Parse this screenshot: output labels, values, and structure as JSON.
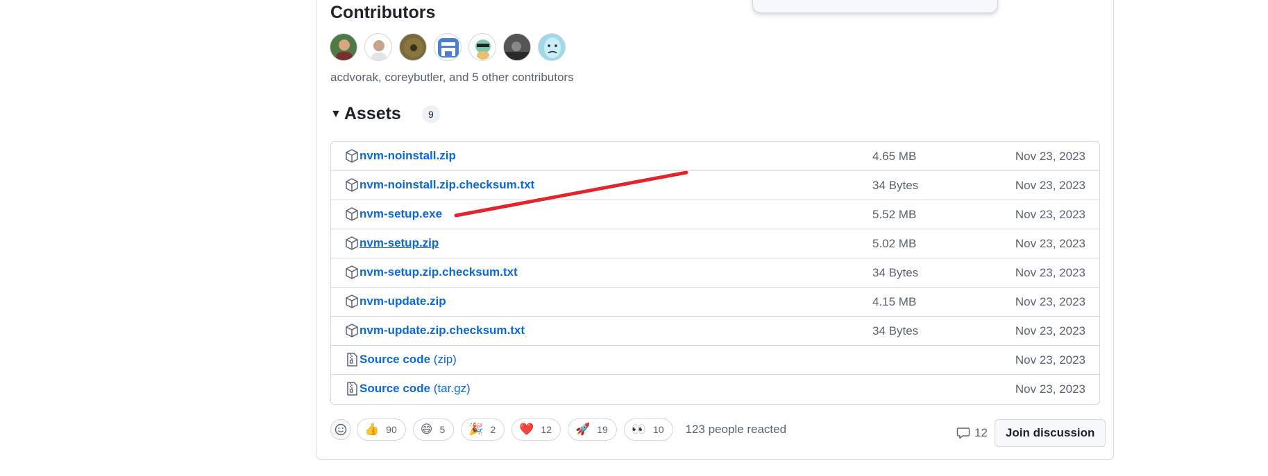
{
  "contributors": {
    "heading": "Contributors",
    "summary": "acdvorak, coreybutler, and 5 other contributors",
    "avatars": [
      {
        "name": "acdvorak",
        "color": "#4f7a45"
      },
      {
        "name": "coreybutler",
        "color": "#e8e8e8"
      },
      {
        "name": "contributor-3",
        "color": "#7a6a3a"
      },
      {
        "name": "contributor-4",
        "color": "#4a7fd4"
      },
      {
        "name": "contributor-5",
        "color": "#7fc9b2"
      },
      {
        "name": "contributor-6",
        "color": "#3a3a3a"
      },
      {
        "name": "contributor-7",
        "color": "#9fd8e8"
      }
    ]
  },
  "assets": {
    "heading": "Assets",
    "count": "9",
    "files": [
      {
        "name": "nvm-noinstall.zip",
        "size": "4.65 MB",
        "date": "Nov 23, 2023",
        "icon": "package-icon"
      },
      {
        "name": "nvm-noinstall.zip.checksum.txt",
        "size": "34 Bytes",
        "date": "Nov 23, 2023",
        "icon": "package-icon"
      },
      {
        "name": "nvm-setup.exe",
        "size": "5.52 MB",
        "date": "Nov 23, 2023",
        "icon": "package-icon"
      },
      {
        "name": "nvm-setup.zip",
        "size": "5.02 MB",
        "date": "Nov 23, 2023",
        "icon": "package-icon",
        "hovered": true
      },
      {
        "name": "nvm-setup.zip.checksum.txt",
        "size": "34 Bytes",
        "date": "Nov 23, 2023",
        "icon": "package-icon"
      },
      {
        "name": "nvm-update.zip",
        "size": "4.15 MB",
        "date": "Nov 23, 2023",
        "icon": "package-icon"
      },
      {
        "name": "nvm-update.zip.checksum.txt",
        "size": "34 Bytes",
        "date": "Nov 23, 2023",
        "icon": "package-icon"
      }
    ],
    "source": [
      {
        "name": "Source code",
        "ext": "(zip)",
        "date": "Nov 23, 2023",
        "icon": "file-zip-icon"
      },
      {
        "name": "Source code",
        "ext": "(tar.gz)",
        "date": "Nov 23, 2023",
        "icon": "file-zip-icon"
      }
    ]
  },
  "reactions": {
    "items": [
      {
        "emoji": "👍",
        "count": "90",
        "icon": "thumbs-up-icon"
      },
      {
        "emoji": "😄",
        "count": "5",
        "icon": "laugh-icon"
      },
      {
        "emoji": "🎉",
        "count": "2",
        "icon": "hooray-icon"
      },
      {
        "emoji": "❤️",
        "count": "12",
        "icon": "heart-icon"
      },
      {
        "emoji": "🚀",
        "count": "19",
        "icon": "rocket-icon"
      },
      {
        "emoji": "👀",
        "count": "10",
        "icon": "eyes-icon"
      }
    ],
    "summary": "123 people reacted"
  },
  "discussion": {
    "comment_count": "12",
    "join_label": "Join discussion"
  },
  "colors": {
    "link": "#0969da",
    "muted": "#59636e",
    "border": "#d0d7de",
    "annotation": "#e3242b"
  }
}
